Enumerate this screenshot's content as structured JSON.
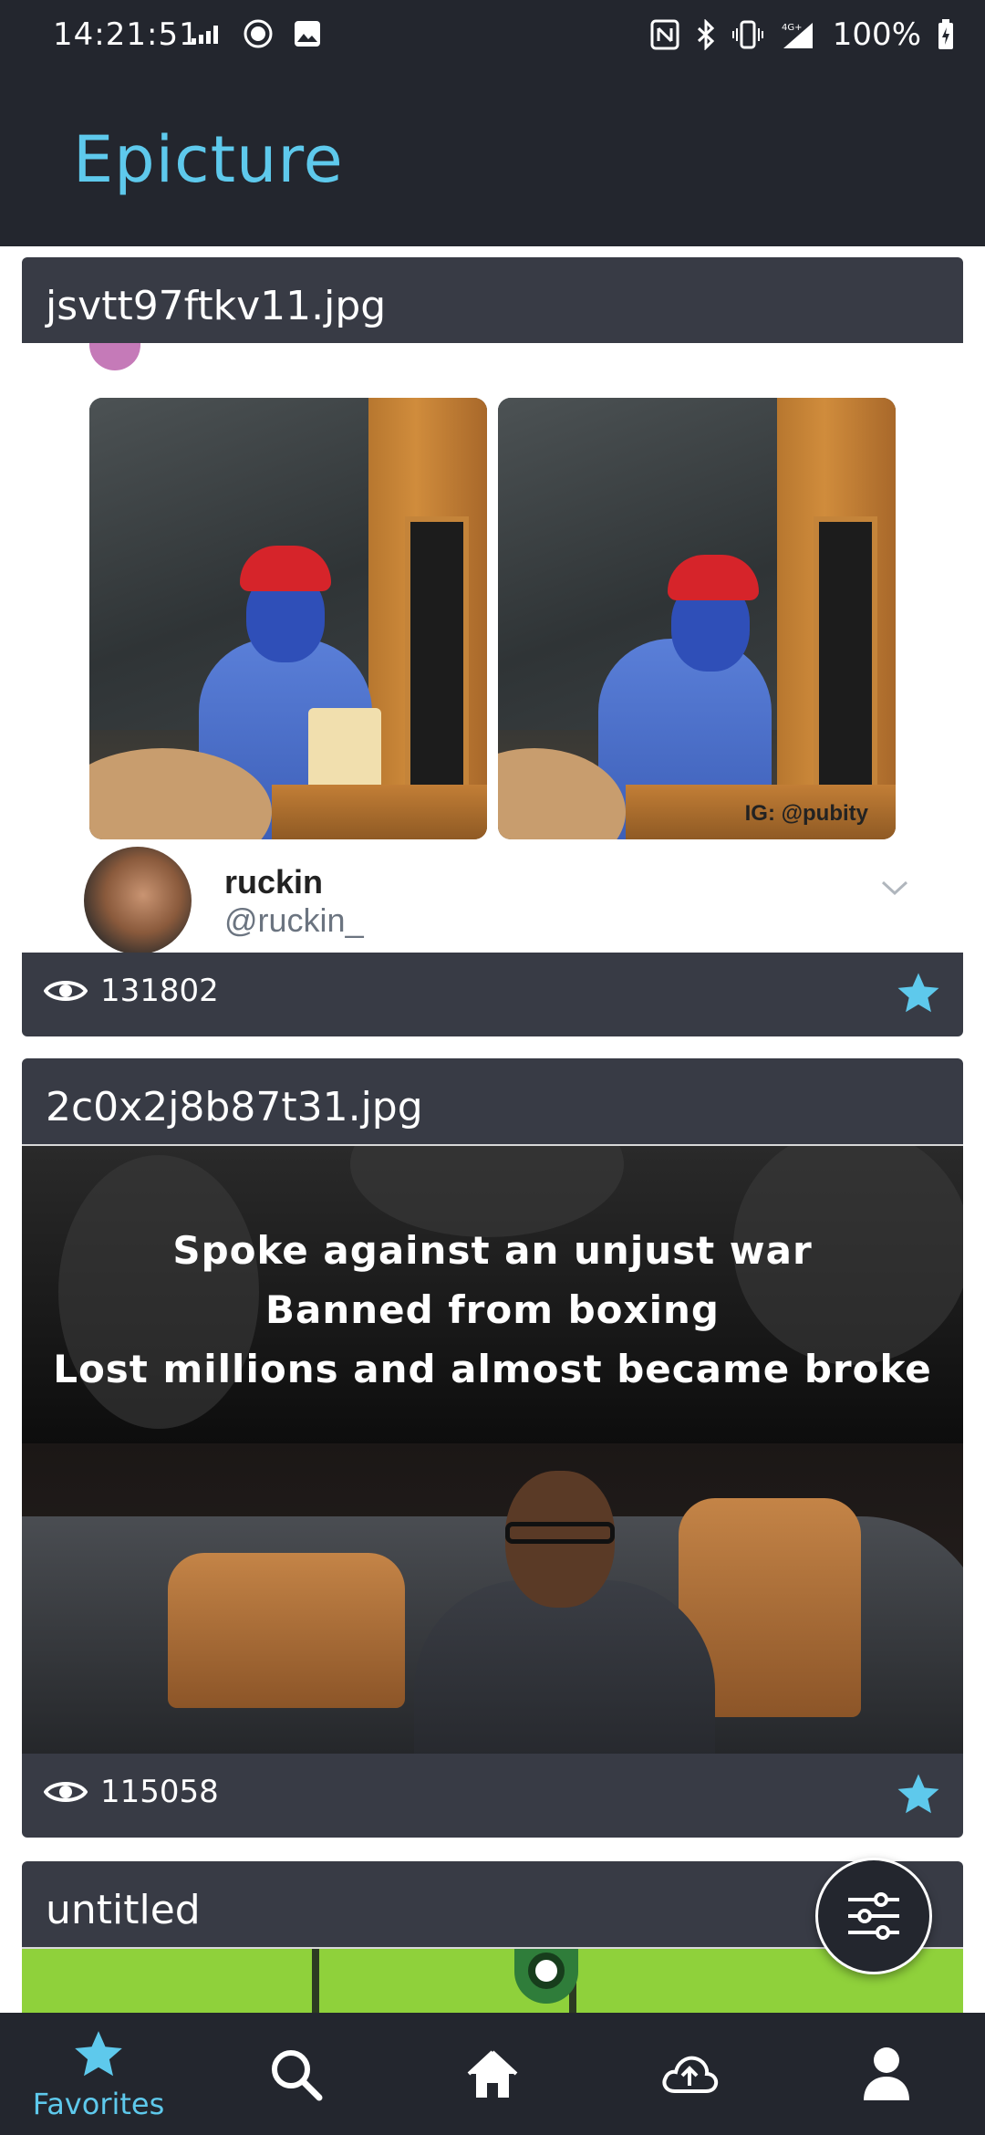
{
  "status_bar": {
    "time": "14:21:51",
    "battery": "100%",
    "network": "4G+"
  },
  "app": {
    "title": "Epicture",
    "accent_color": "#5ec9ec",
    "bar_color": "#23262e",
    "card_color": "#383b45"
  },
  "posts": [
    {
      "title": "jsvtt97ftkv11.jpg",
      "views": "131802",
      "favorited": true,
      "image": {
        "watermark": "IG: @pubity",
        "tweet_name": "ruckin",
        "tweet_handle": "@ruckin_"
      }
    },
    {
      "title": "2c0x2j8b87t31.jpg",
      "views": "115058",
      "favorited": true,
      "image": {
        "caption_lines": [
          "Spoke against an unjust war",
          "Banned from boxing",
          "Lost millions and almost became broke"
        ]
      }
    },
    {
      "title": "untitled"
    }
  ],
  "fab": {
    "icon": "sliders-icon"
  },
  "bottom_nav": [
    {
      "label": "Favorites",
      "icon": "star-icon",
      "active": true
    },
    {
      "label": "",
      "icon": "search-icon",
      "active": false
    },
    {
      "label": "",
      "icon": "home-icon",
      "active": false
    },
    {
      "label": "",
      "icon": "cloud-upload-icon",
      "active": false
    },
    {
      "label": "",
      "icon": "person-icon",
      "active": false
    }
  ]
}
